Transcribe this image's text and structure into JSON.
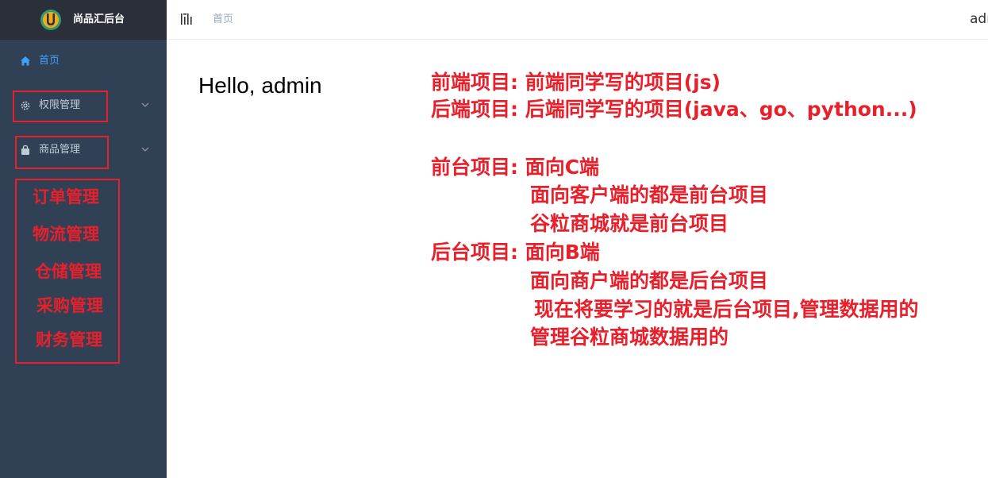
{
  "app": {
    "title": "尚品汇后台"
  },
  "colors": {
    "sidebar_bg": "#304156",
    "accent": "#409eff",
    "annotation_red": "#e8202b"
  },
  "sidebar": {
    "items": [
      {
        "label": "首页",
        "icon": "home-icon"
      },
      {
        "label": "权限管理",
        "icon": "gear-icon"
      },
      {
        "label": "商品管理",
        "icon": "shopping-bag-icon"
      }
    ],
    "annotated_items": [
      "订单管理",
      "物流管理",
      "仓储管理",
      "采购管理",
      "财务管理"
    ]
  },
  "header": {
    "breadcrumb": "首页",
    "user": "admin"
  },
  "main": {
    "greeting": "Hello, admin",
    "notes": [
      "前端项目: 前端同学写的项目(js)",
      "后端项目: 后端同学写的项目(java、go、python...)",
      "前台项目: 面向C端",
      "面向客户端的都是前台项目",
      "谷粒商城就是前台项目",
      "后台项目: 面向B端",
      "面向商户端的都是后台项目",
      "现在将要学习的就是后台项目,管理数据用的",
      "管理谷粒商城数据用的"
    ]
  }
}
